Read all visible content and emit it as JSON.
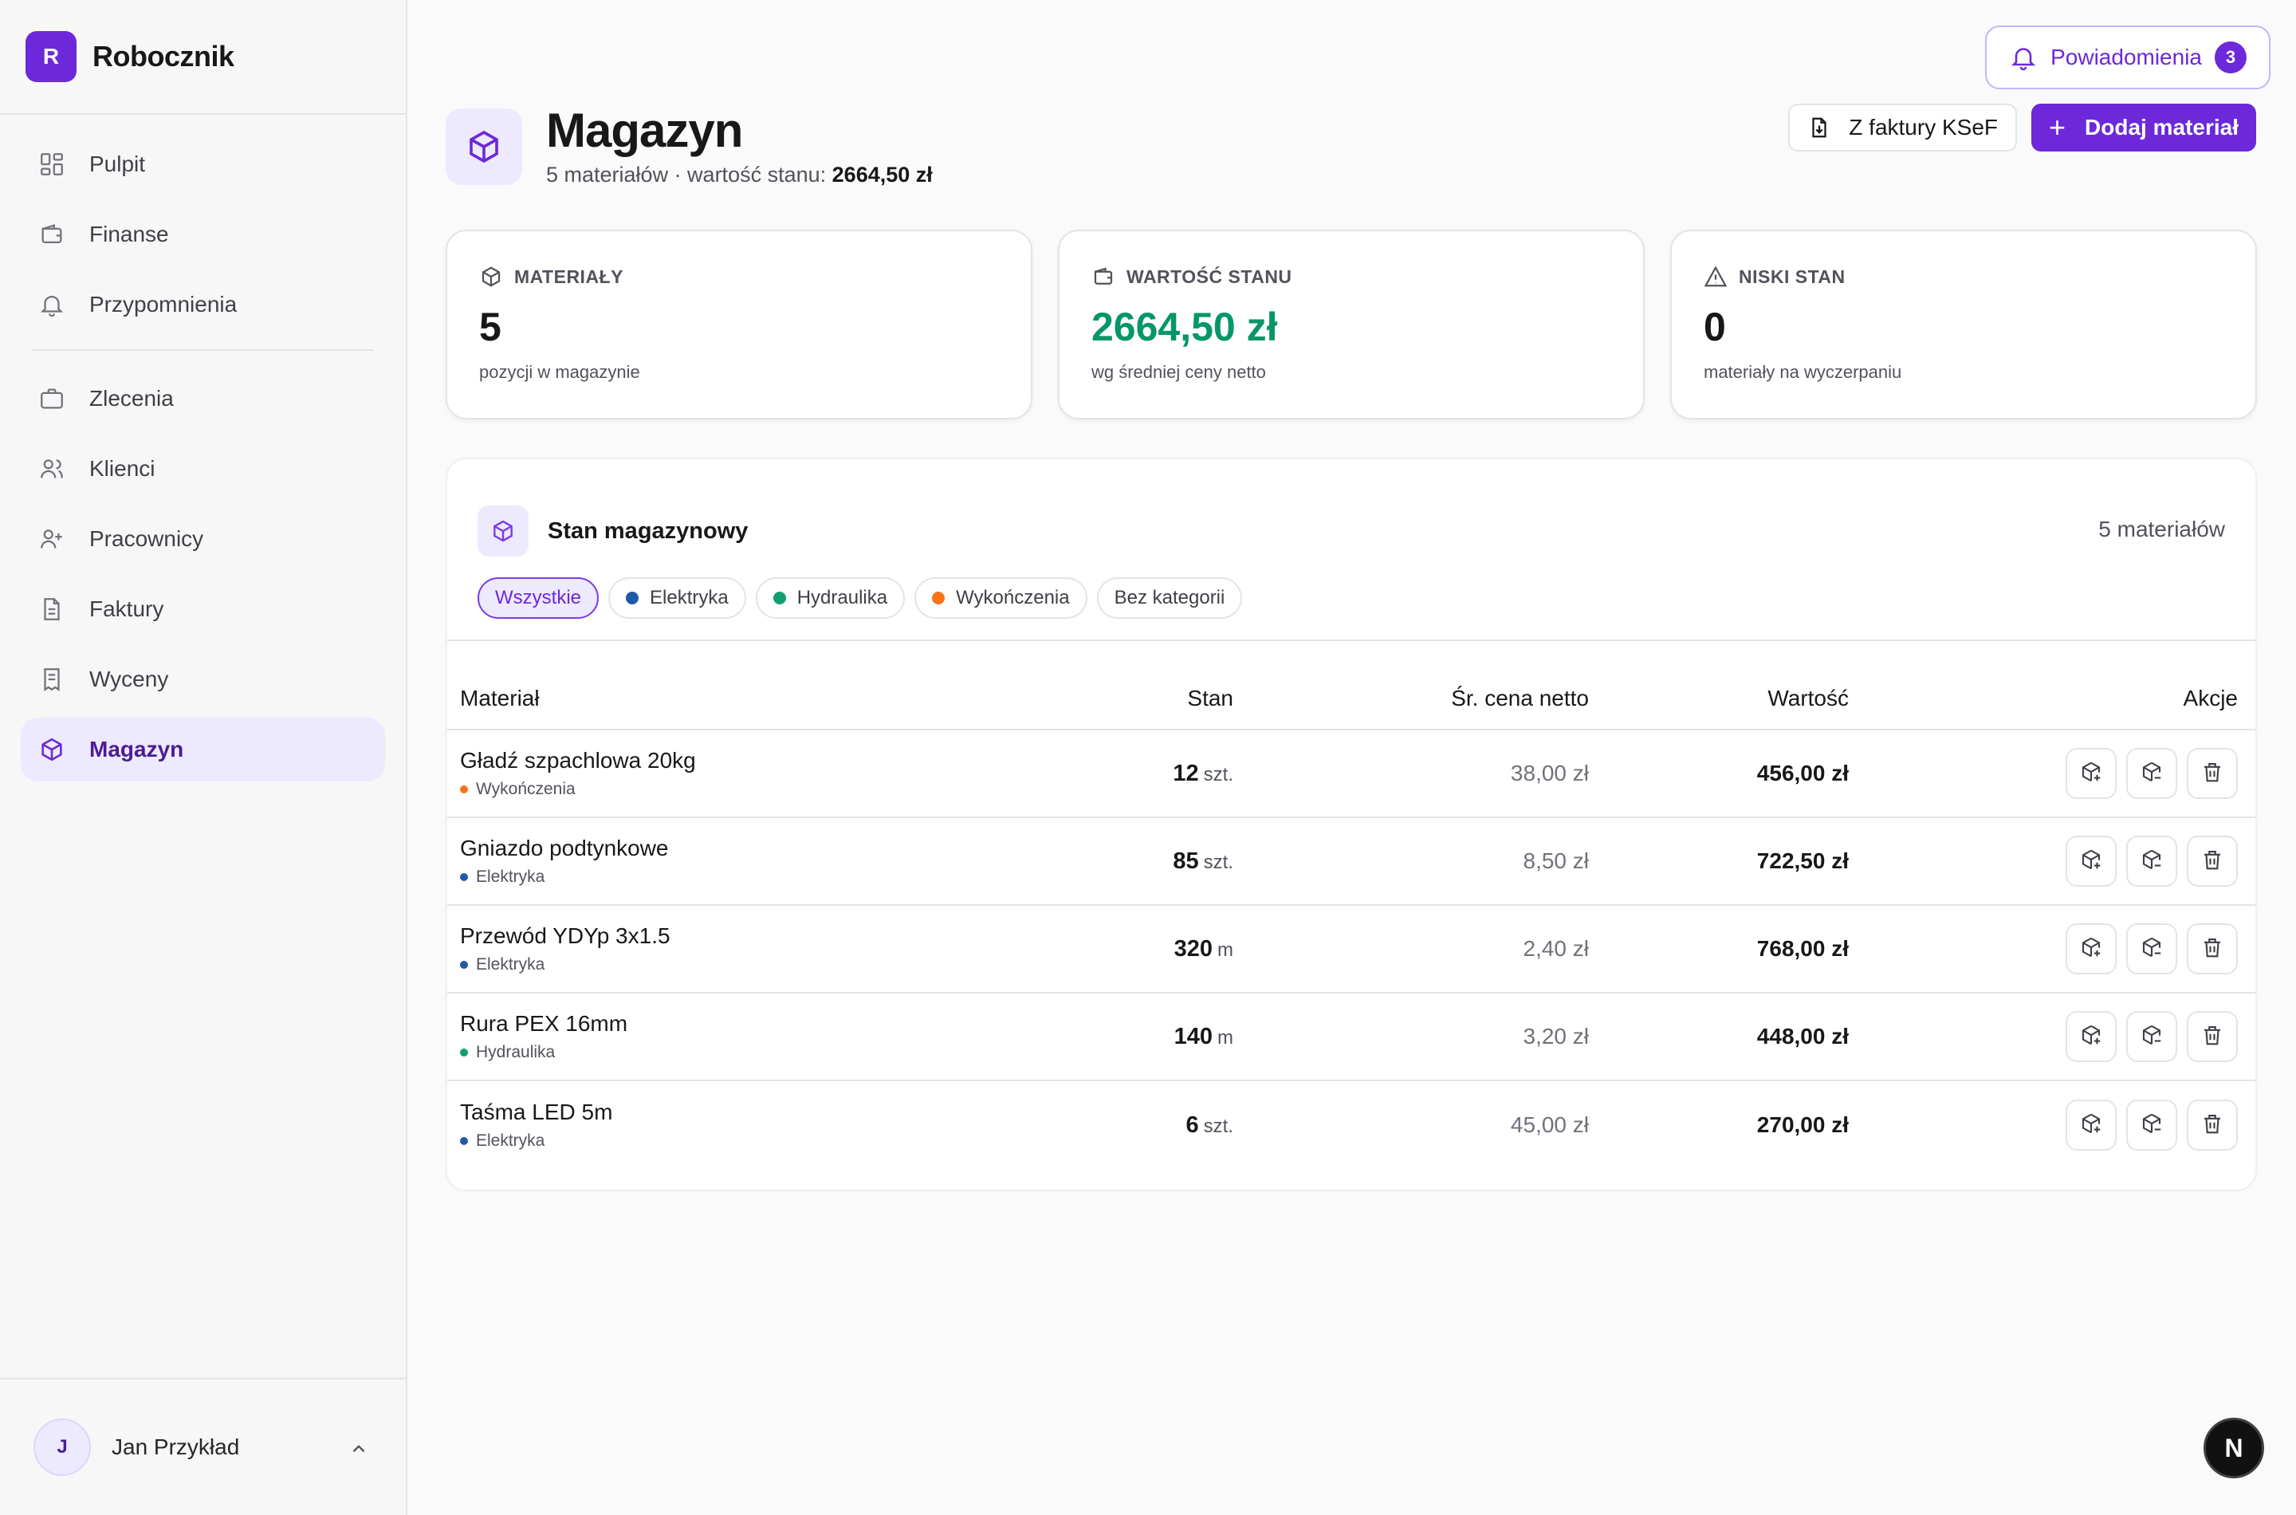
{
  "brand": {
    "logo_letter": "R",
    "name": "Robocznik"
  },
  "sidebar": {
    "items": [
      {
        "label": "Pulpit",
        "icon": "dashboard-icon"
      },
      {
        "label": "Finanse",
        "icon": "wallet-icon"
      },
      {
        "label": "Przypomnienia",
        "icon": "bell-icon"
      },
      {
        "label": "Zlecenia",
        "icon": "briefcase-icon"
      },
      {
        "label": "Klienci",
        "icon": "users-icon"
      },
      {
        "label": "Pracownicy",
        "icon": "user-plus-icon"
      },
      {
        "label": "Faktury",
        "icon": "file-icon"
      },
      {
        "label": "Wyceny",
        "icon": "receipt-icon"
      },
      {
        "label": "Magazyn",
        "icon": "package-icon",
        "active": true
      }
    ]
  },
  "user": {
    "initial": "J",
    "name": "Jan Przykład"
  },
  "notifications": {
    "label": "Powiadomienia",
    "count": "3"
  },
  "header": {
    "title": "Magazyn",
    "subtitle_prefix": "5 materiałów · wartość stanu:",
    "subtitle_value": "2664,50 zł",
    "ksef_label": "Z faktury KSeF",
    "add_label": "Dodaj materiał"
  },
  "stats": [
    {
      "label": "MATERIAŁY",
      "value": "5",
      "hint": "pozycji w magazynie",
      "icon": "package-icon"
    },
    {
      "label": "WARTOŚĆ STANU",
      "value": "2664,50 zł",
      "hint": "wg średniej ceny netto",
      "icon": "wallet-icon"
    },
    {
      "label": "NISKI STAN",
      "value": "0",
      "hint": "materiały na wyczerpaniu",
      "icon": "warning-icon"
    }
  ],
  "panel": {
    "title": "Stan magazynowy",
    "count": "5 materiałów",
    "filters": [
      {
        "label": "Wszystkie",
        "active": true
      },
      {
        "label": "Elektryka",
        "color": "#1e5aa8"
      },
      {
        "label": "Hydraulika",
        "color": "#10a070"
      },
      {
        "label": "Wykończenia",
        "color": "#f97316"
      },
      {
        "label": "Bez kategorii"
      }
    ],
    "columns": {
      "name": "Materiał",
      "stan": "Stan",
      "cena": "Śr. cena netto",
      "wartosc": "Wartość",
      "akcje": "Akcje"
    },
    "rows": [
      {
        "name": "Gładź szpachlowa 20kg",
        "category": "Wykończenia",
        "cat_color": "#f97316",
        "qty": "12",
        "unit": "szt.",
        "price": "38,00 zł",
        "value": "456,00 zł"
      },
      {
        "name": "Gniazdo podtynkowe",
        "category": "Elektryka",
        "cat_color": "#1e5aa8",
        "qty": "85",
        "unit": "szt.",
        "price": "8,50 zł",
        "value": "722,50 zł"
      },
      {
        "name": "Przewód YDYp 3x1.5",
        "category": "Elektryka",
        "cat_color": "#1e5aa8",
        "qty": "320",
        "unit": "m",
        "price": "2,40 zł",
        "value": "768,00 zł"
      },
      {
        "name": "Rura PEX 16mm",
        "category": "Hydraulika",
        "cat_color": "#10a070",
        "qty": "140",
        "unit": "m",
        "price": "3,20 zł",
        "value": "448,00 zł"
      },
      {
        "name": "Taśma LED 5m",
        "category": "Elektryka",
        "cat_color": "#1e5aa8",
        "qty": "6",
        "unit": "szt.",
        "price": "45,00 zł",
        "value": "270,00 zł"
      }
    ]
  },
  "dev_badge": "N"
}
